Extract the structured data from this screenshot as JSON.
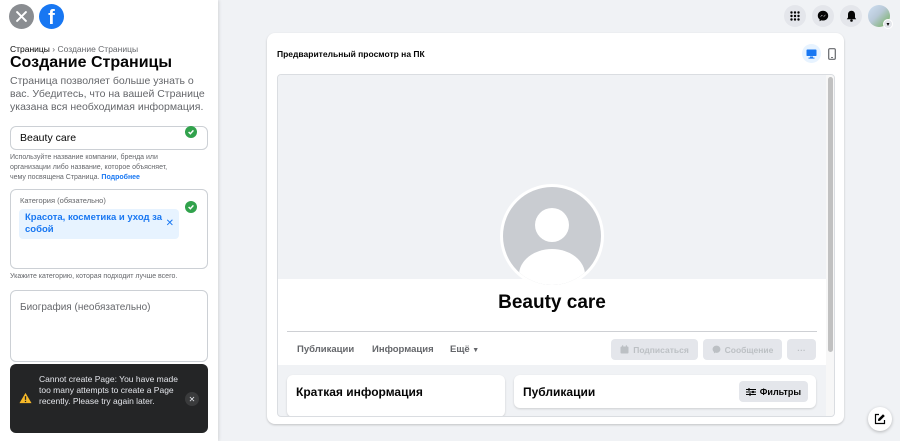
{
  "left": {
    "breadcrumb": {
      "parent": "Страницы",
      "separator": " › ",
      "current": "Создание Страницы"
    },
    "title": "Создание Страницы",
    "description": "Страница позволяет больше узнать о вас. Убедитесь, что на вашей Странице указана вся необходимая информация.",
    "name_field": {
      "value": "Beauty care"
    },
    "name_help": "Используйте название компании, бренда или организации либо название, которое объясняет, чему посвящена Страница.",
    "name_help_link": "Подробнее",
    "category_field": {
      "label": "Категория (обязательно)",
      "chip": "Красота, косметика и уход за собой",
      "chip_remove": "✕"
    },
    "category_help": "Укажите категорию, которая подходит лучше всего.",
    "bio_field": {
      "placeholder": "Биография (необязательно)"
    }
  },
  "toast": {
    "message": "Cannot create Page: You have made too many attempts to create a Page recently. Please try again later.",
    "close": "✕"
  },
  "preview": {
    "title": "Предварительный просмотр на ПК",
    "page_name": "Beauty care",
    "tabs": [
      "Публикации",
      "Информация",
      "Ещё"
    ],
    "buttons": {
      "subscribe": "Подписаться",
      "message": "Сообщение",
      "more": "···"
    },
    "intro_title": "Краткая информация",
    "posts_title": "Публикации",
    "filters": "Фильтры"
  },
  "colors": {
    "accent": "#1877f2",
    "success": "#31a24c",
    "toast_bg": "#242526"
  },
  "icons": [
    "close-icon",
    "facebook-logo",
    "apps-grid-icon",
    "messenger-icon",
    "bell-icon",
    "desktop-icon",
    "mobile-icon",
    "warning-icon",
    "compose-icon"
  ]
}
